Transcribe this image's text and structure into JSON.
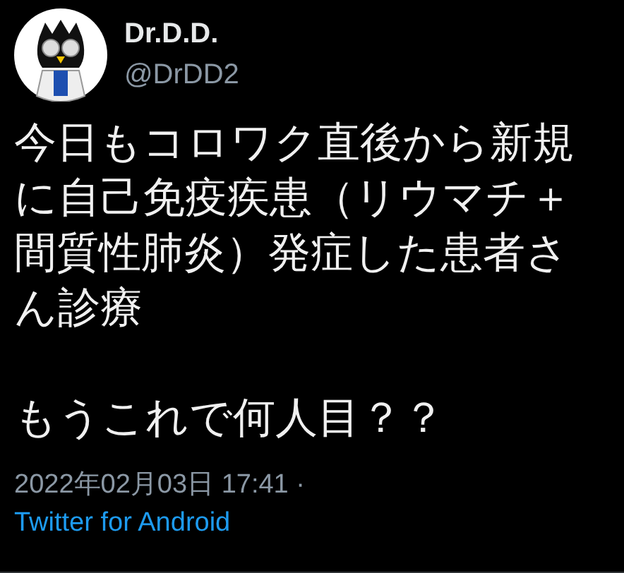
{
  "author": {
    "name": "Dr.D.D.",
    "handle": "@DrDD2"
  },
  "body": [
    "今日もコロワク直後から新規に自己免疫疾患（リウマチ＋間質性肺炎）発症した患者さん診療",
    "もうこれで何人目？？"
  ],
  "timestamp": "2022年02月03日 17:41 ·",
  "source": "Twitter for Android"
}
